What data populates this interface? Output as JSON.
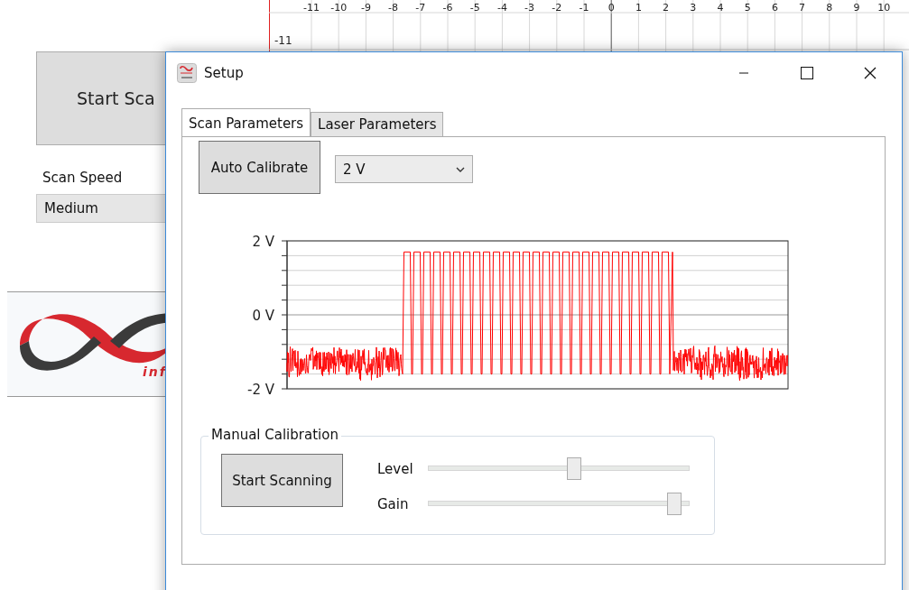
{
  "main_window": {
    "start_button": "Start Sca",
    "scan_speed_label": "Scan Speed",
    "scan_speed_value": "Medium",
    "logo": {
      "tagline": "inf"
    },
    "ruler": {
      "x_labels": [
        "-11",
        "-10",
        "-9",
        "-8",
        "-7",
        "-6",
        "-5",
        "-4",
        "-3",
        "-2",
        "-1",
        "0",
        "1",
        "2",
        "3",
        "4",
        "5",
        "6",
        "7",
        "8",
        "9",
        "10"
      ],
      "y_labels": [
        "-11"
      ]
    }
  },
  "dialog": {
    "title": "Setup",
    "tabs": [
      {
        "label": "Scan Parameters",
        "selected": true
      },
      {
        "label": "Laser Parameters",
        "selected": false
      }
    ],
    "auto_calibrate_button": "Auto Calibrate",
    "range_select": "2 V",
    "scope": {
      "y_labels": [
        "2 V",
        "0 V",
        "-2 V"
      ]
    },
    "manual_calibration": {
      "title": "Manual Calibration",
      "start_button": "Start Scanning",
      "sliders": [
        {
          "label": "Level",
          "level": 0.56
        },
        {
          "label": "Gain",
          "level": 0.94
        }
      ]
    }
  }
}
